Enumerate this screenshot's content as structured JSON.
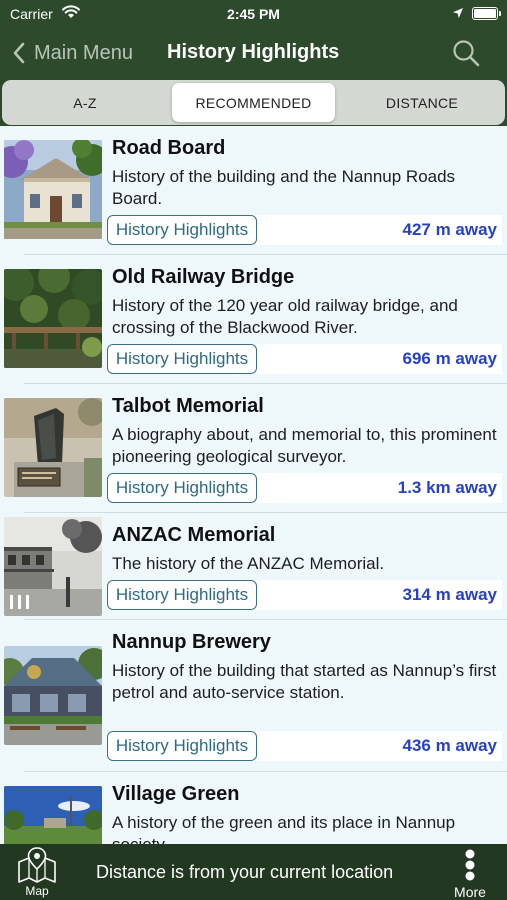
{
  "status_bar": {
    "carrier": "Carrier",
    "time": "2:45 PM"
  },
  "nav": {
    "back_label": "Main Menu",
    "title": "History Highlights"
  },
  "segments": [
    "A-Z",
    "RECOMMENDED",
    "DISTANCE"
  ],
  "selected_segment": "RECOMMENDED",
  "items": [
    {
      "title": "Road Board",
      "description": "History of the building and the Nannup Roads Board.",
      "tag": "History Highlights",
      "distance": "427 m away",
      "image": "road-board-building-photo"
    },
    {
      "title": "Old Railway Bridge",
      "description": "History of the 120 year old railway bridge, and crossing of the Blackwood River.",
      "tag": "History Highlights",
      "distance": "696 m away",
      "image": "railway-bridge-photo"
    },
    {
      "title": "Talbot Memorial",
      "description": "A biography about, and memorial to, this prominent pioneering geological surveyor.",
      "tag": "History Highlights",
      "distance": "1.3 km away",
      "image": "memorial-stone-photo"
    },
    {
      "title": "ANZAC Memorial",
      "description": "The history of the ANZAC Memorial.",
      "tag": "History Highlights",
      "distance": "314 m away",
      "image": "historic-street-photo"
    },
    {
      "title": "Nannup Brewery",
      "description": "History of the building that started as Nannup’s first petrol and auto-service station.",
      "tag": "History Highlights",
      "distance": "436 m away",
      "image": "brewery-building-photo"
    },
    {
      "title": "Village Green",
      "description": "A history of the green and its place in Nannup society.",
      "tag": "",
      "distance": "",
      "image": "village-green-photo"
    }
  ],
  "footer": {
    "map_label": "Map",
    "note": "Distance is from your current location",
    "more_label": "More"
  },
  "colors": {
    "header": "#2e4a2c",
    "footer": "#223821",
    "list_bg": "#eef8fa",
    "distance": "#2741c4",
    "tag_border": "#3a6e85"
  }
}
